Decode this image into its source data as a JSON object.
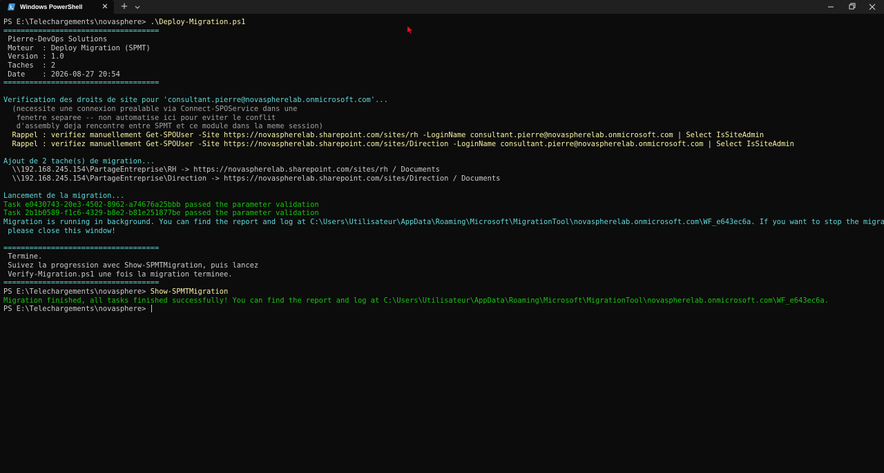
{
  "titlebar": {
    "tab_title": "Windows PowerShell",
    "close_tab_glyph": "✕",
    "new_tab_glyph": "+",
    "accent": "#3a96dd"
  },
  "terminal": {
    "colors": {
      "background": "#0c0c0c",
      "default": "#cccccc",
      "cyan": "#61d6d6",
      "yellow": "#f9f1a5",
      "green": "#16c60c",
      "dim": "#a0a0a0"
    },
    "lines": [
      {
        "segments": [
          {
            "text": "PS E:\\Telechargements\\novasphere> ",
            "color": "w"
          },
          {
            "text": ".\\Deploy-Migration.ps1",
            "color": "y"
          }
        ]
      },
      {
        "segments": [
          {
            "text": "====================================",
            "color": "c"
          }
        ]
      },
      {
        "segments": [
          {
            "text": " Pierre-DevOps Solutions",
            "color": "w"
          }
        ]
      },
      {
        "segments": [
          {
            "text": " Moteur  : Deploy Migration (SPMT)",
            "color": "w"
          }
        ]
      },
      {
        "segments": [
          {
            "text": " Version : 1.0",
            "color": "w"
          }
        ]
      },
      {
        "segments": [
          {
            "text": " Taches  : 2",
            "color": "w"
          }
        ]
      },
      {
        "segments": [
          {
            "text": " Date    : 2026-08-27 20:54",
            "color": "w"
          }
        ]
      },
      {
        "segments": [
          {
            "text": "====================================",
            "color": "c"
          }
        ]
      },
      {
        "segments": []
      },
      {
        "segments": [
          {
            "text": "Verification des droits de site pour 'consultant.pierre@novaspherelab.onmicrosoft.com'...",
            "color": "c"
          }
        ]
      },
      {
        "segments": [
          {
            "text": "  (necessite une connexion prealable via Connect-SPOService dans une",
            "color": "d"
          }
        ]
      },
      {
        "segments": [
          {
            "text": "   fenetre separee -- non automatise ici pour eviter le conflit",
            "color": "d"
          }
        ]
      },
      {
        "segments": [
          {
            "text": "   d'assembly deja rencontre entre SPMT et ce module dans la meme session)",
            "color": "d"
          }
        ]
      },
      {
        "segments": [
          {
            "text": "  Rappel : verifiez manuellement Get-SPOUser -Site https://novaspherelab.sharepoint.com/sites/rh -LoginName consultant.pierre@novaspherelab.onmicrosoft.com | Select IsSiteAdmin",
            "color": "y"
          }
        ]
      },
      {
        "segments": [
          {
            "text": "  Rappel : verifiez manuellement Get-SPOUser -Site https://novaspherelab.sharepoint.com/sites/Direction -LoginName consultant.pierre@novaspherelab.onmicrosoft.com | Select IsSiteAdmin",
            "color": "y"
          }
        ]
      },
      {
        "segments": []
      },
      {
        "segments": [
          {
            "text": "Ajout de 2 tache(s) de migration...",
            "color": "c"
          }
        ]
      },
      {
        "segments": [
          {
            "text": "  \\\\192.168.245.154\\PartageEntreprise\\RH -> https://novaspherelab.sharepoint.com/sites/rh / Documents",
            "color": "w"
          }
        ]
      },
      {
        "segments": [
          {
            "text": "  \\\\192.168.245.154\\PartageEntreprise\\Direction -> https://novaspherelab.sharepoint.com/sites/Direction / Documents",
            "color": "w"
          }
        ]
      },
      {
        "segments": []
      },
      {
        "segments": [
          {
            "text": "Lancement de la migration...",
            "color": "c"
          }
        ]
      },
      {
        "segments": [
          {
            "text": "Task e0430743-20e3-4502-8962-a74676a25bbb passed the parameter validation",
            "color": "g"
          }
        ]
      },
      {
        "segments": [
          {
            "text": "Task 2b1b0589-f1c6-4329-b8e2-b81e251877be passed the parameter validation",
            "color": "g"
          }
        ]
      },
      {
        "segments": [
          {
            "text": "Migration is running in background. You can find the report and log at C:\\Users\\Utilisateur\\AppData\\Roaming\\Microsoft\\MigrationTool\\novaspherelab.onmicrosoft.com\\WF_e643ec6a. If you want to stop the migration,",
            "color": "c"
          }
        ]
      },
      {
        "segments": [
          {
            "text": " please close this window!",
            "color": "c"
          }
        ]
      },
      {
        "segments": []
      },
      {
        "segments": [
          {
            "text": "====================================",
            "color": "c"
          }
        ]
      },
      {
        "segments": [
          {
            "text": " Termine.",
            "color": "w"
          }
        ]
      },
      {
        "segments": [
          {
            "text": " Suivez la progression avec Show-SPMTMigration, puis lancez",
            "color": "w"
          }
        ]
      },
      {
        "segments": [
          {
            "text": " Verify-Migration.ps1 une fois la migration terminee.",
            "color": "w"
          }
        ]
      },
      {
        "segments": [
          {
            "text": "====================================",
            "color": "c"
          }
        ]
      },
      {
        "segments": [
          {
            "text": "PS E:\\Telechargements\\novasphere> ",
            "color": "w"
          },
          {
            "text": "Show-SPMTMigration",
            "color": "y"
          }
        ]
      },
      {
        "segments": [
          {
            "text": "Migration finished, all tasks finished successfully! You can find the report and log at C:\\Users\\Utilisateur\\AppData\\Roaming\\Microsoft\\MigrationTool\\novaspherelab.onmicrosoft.com\\WF_e643ec6a.",
            "color": "g"
          }
        ]
      },
      {
        "segments": [
          {
            "text": "PS E:\\Telechargements\\novasphere> ",
            "color": "w"
          }
        ],
        "cursor": true
      }
    ]
  }
}
